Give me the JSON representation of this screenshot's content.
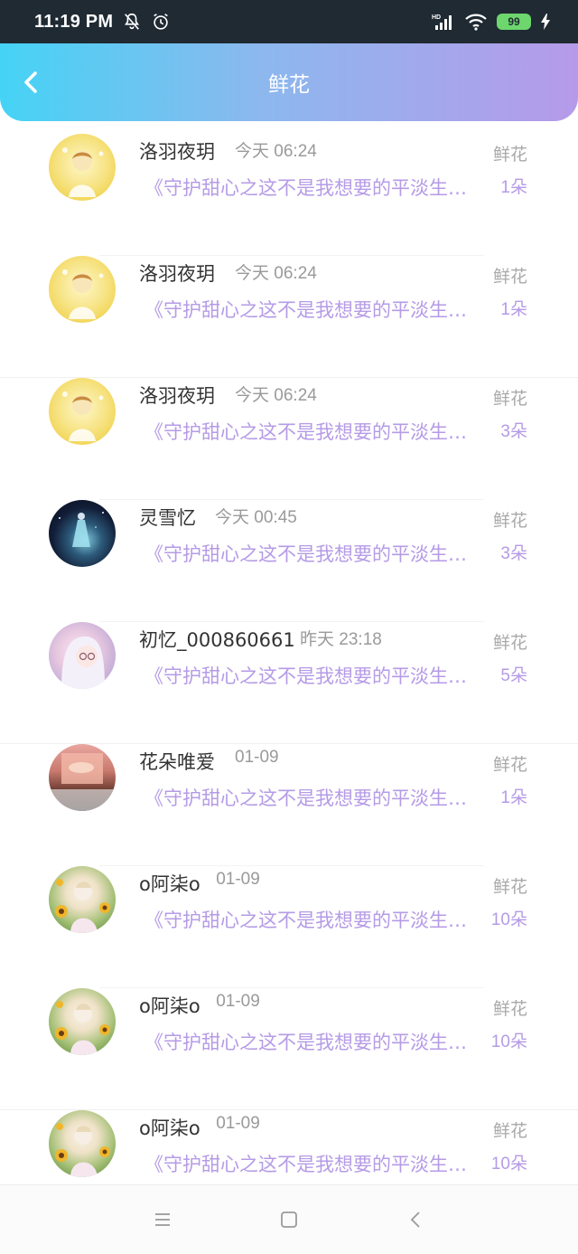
{
  "status_bar": {
    "time": "11:19 PM",
    "battery": "99",
    "icons": [
      "dnd-off-icon",
      "alarm-icon",
      "signal-icon",
      "wifi-icon",
      "battery-icon",
      "charging-icon"
    ]
  },
  "header": {
    "title": "鲜花",
    "back_icon": "chevron-left-icon"
  },
  "list": [
    {
      "name": "洛羽夜玥",
      "time": "今天 06:24",
      "book": "《守护甜心之这不是我想要的平淡生活》",
      "gift_label": "鲜花",
      "count": "1朵",
      "avatar": "yellow"
    },
    {
      "name": "洛羽夜玥",
      "time": "今天 06:24",
      "book": "《守护甜心之这不是我想要的平淡生活》",
      "gift_label": "鲜花",
      "count": "1朵",
      "avatar": "yellow"
    },
    {
      "name": "洛羽夜玥",
      "time": "今天 06:24",
      "book": "《守护甜心之这不是我想要的平淡生活》",
      "gift_label": "鲜花",
      "count": "3朵",
      "avatar": "yellow"
    },
    {
      "name": "灵雪忆",
      "time": "今天 00:45",
      "book": "《守护甜心之这不是我想要的平淡生活》",
      "gift_label": "鲜花",
      "count": "3朵",
      "avatar": "night"
    },
    {
      "name": "初忆_000860661",
      "time": "昨天 23:18",
      "book": "《守护甜心之这不是我想要的平淡生活》",
      "gift_label": "鲜花",
      "count": "5朵",
      "avatar": "pink"
    },
    {
      "name": "花朵唯爱",
      "time": "01-09",
      "book": "《守护甜心之这不是我想要的平淡生活》",
      "gift_label": "鲜花",
      "count": "1朵",
      "avatar": "sunset"
    },
    {
      "name": "o阿柒o",
      "time": "01-09",
      "book": "《守护甜心之这不是我想要的平淡生活》",
      "gift_label": "鲜花",
      "count": "10朵",
      "avatar": "sunflower"
    },
    {
      "name": "o阿柒o",
      "time": "01-09",
      "book": "《守护甜心之这不是我想要的平淡生活》",
      "gift_label": "鲜花",
      "count": "10朵",
      "avatar": "sunflower"
    },
    {
      "name": "o阿柒o",
      "time": "01-09",
      "book": "《守护甜心之这不是我想要的平淡生活》",
      "gift_label": "鲜花",
      "count": "10朵",
      "avatar": "sunflower"
    }
  ],
  "nav_bar": {
    "icons": [
      "menu-icon",
      "home-square-icon",
      "back-triangle-icon"
    ]
  },
  "colors": {
    "accent_purple": "#b59be6",
    "header_start": "#45d3f5",
    "header_end": "#b69ae9"
  }
}
